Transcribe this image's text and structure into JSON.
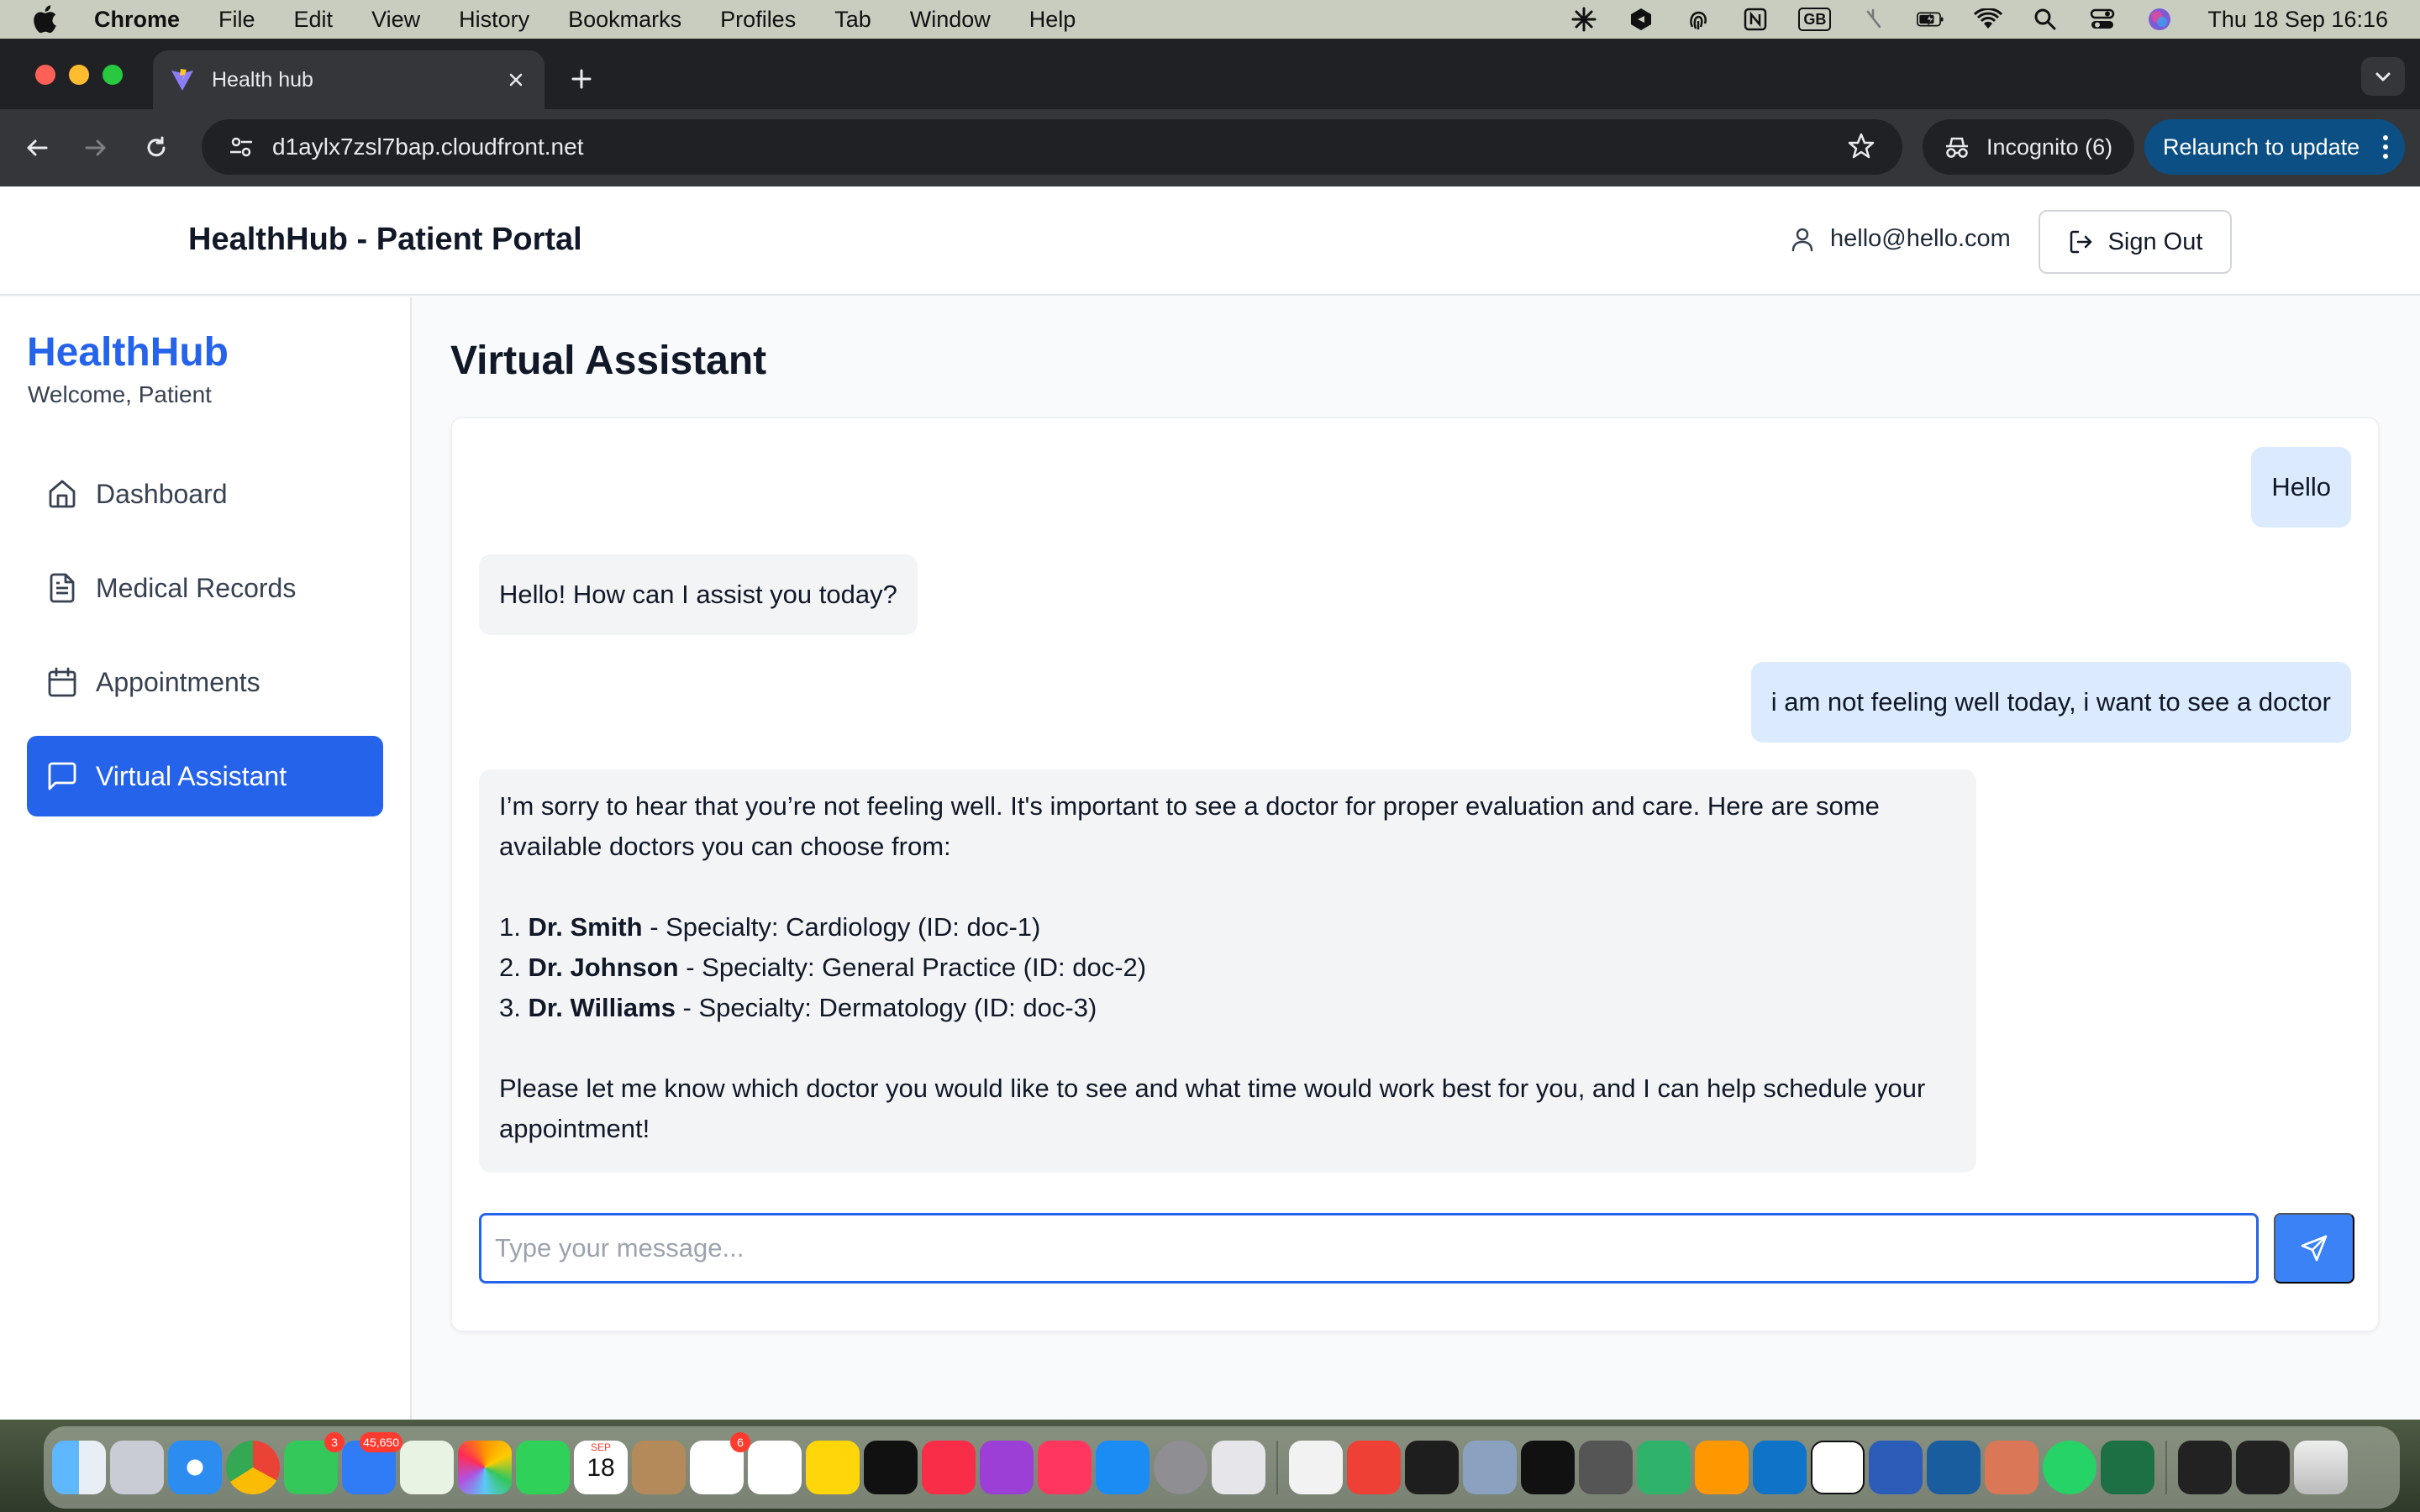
{
  "menubar": {
    "app_name": "Chrome",
    "items": [
      "File",
      "Edit",
      "View",
      "History",
      "Bookmarks",
      "Profiles",
      "Tab",
      "Window",
      "Help"
    ],
    "status_gb": "GB",
    "clock": "Thu 18 Sep  16:16"
  },
  "browser": {
    "tab_title": "Health hub",
    "url": "d1aylx7zsl7bap.cloudfront.net",
    "incognito_label": "Incognito (6)",
    "relaunch_label": "Relaunch to update"
  },
  "header": {
    "title": "HealthHub - Patient Portal",
    "user_email": "hello@hello.com",
    "signout_label": "Sign Out"
  },
  "sidebar": {
    "brand": "HealthHub",
    "welcome": "Welcome, Patient",
    "items": [
      {
        "label": "Dashboard",
        "icon": "home-icon"
      },
      {
        "label": "Medical Records",
        "icon": "document-icon"
      },
      {
        "label": "Appointments",
        "icon": "calendar-icon"
      },
      {
        "label": "Virtual Assistant",
        "icon": "chat-icon",
        "active": true
      }
    ]
  },
  "main": {
    "title": "Virtual Assistant",
    "messages": {
      "m1": "Hello",
      "m2": "Hello! How can I assist you today?",
      "m3": "i am not feeling well today, i want to see a doctor",
      "m4": {
        "intro": "I’m sorry to hear that you’re not feeling well. It's important to see a doctor for proper evaluation and care. Here are some available doctors you can choose from:",
        "doctors": [
          {
            "num": "1.",
            "name": "Dr. Smith",
            "detail": " - Specialty: Cardiology (ID: doc-1)"
          },
          {
            "num": "2.",
            "name": "Dr. Johnson",
            "detail": " - Specialty: General Practice (ID: doc-2)"
          },
          {
            "num": "3.",
            "name": "Dr. Williams",
            "detail": " - Specialty: Dermatology (ID: doc-3)"
          }
        ],
        "outro": "Please let me know which doctor you would like to see and what time would work best for you, and I can help schedule your appointment!"
      }
    },
    "input_placeholder": "Type your message...",
    "input_value": ""
  },
  "dock": {
    "badges": {
      "messages": "3",
      "mail": "45,650",
      "reminders": "6"
    },
    "calendar_month": "SEP",
    "calendar_day": "18"
  },
  "colors": {
    "primary": "#2563eb",
    "user_bubble": "#dbeafe",
    "bot_bubble": "#f3f4f6",
    "relaunch": "#0b4f84"
  }
}
